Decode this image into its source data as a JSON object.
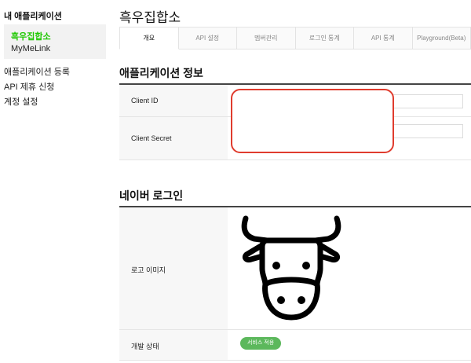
{
  "sidebar": {
    "title": "내 애플리케이션",
    "apps": [
      "흑우집합소",
      "MyMeLink"
    ],
    "links": [
      "애플리케이션 등록",
      "API 제휴 신청",
      "계정 설정"
    ]
  },
  "main": {
    "app_name": "흑우집합소",
    "tabs": [
      "개요",
      "API 설정",
      "멤버관리",
      "로그인 통계",
      "API 통계",
      "Playground(Beta)"
    ],
    "active_tab": "개요",
    "app_info": {
      "title": "애플리케이션 정보",
      "client_id_label": "Client ID",
      "client_secret_label": "Client Secret"
    },
    "naver_login": {
      "title": "네이버 로그인",
      "logo_label": "로고 이미지",
      "status_label": "개발 상태",
      "status_value": "서비스 적용"
    }
  },
  "colors": {
    "active_green": "#1ec800",
    "badge_green": "#5cb85c",
    "highlight_red": "#e03c2e"
  },
  "icons": {
    "logo": "cow-face-icon"
  }
}
